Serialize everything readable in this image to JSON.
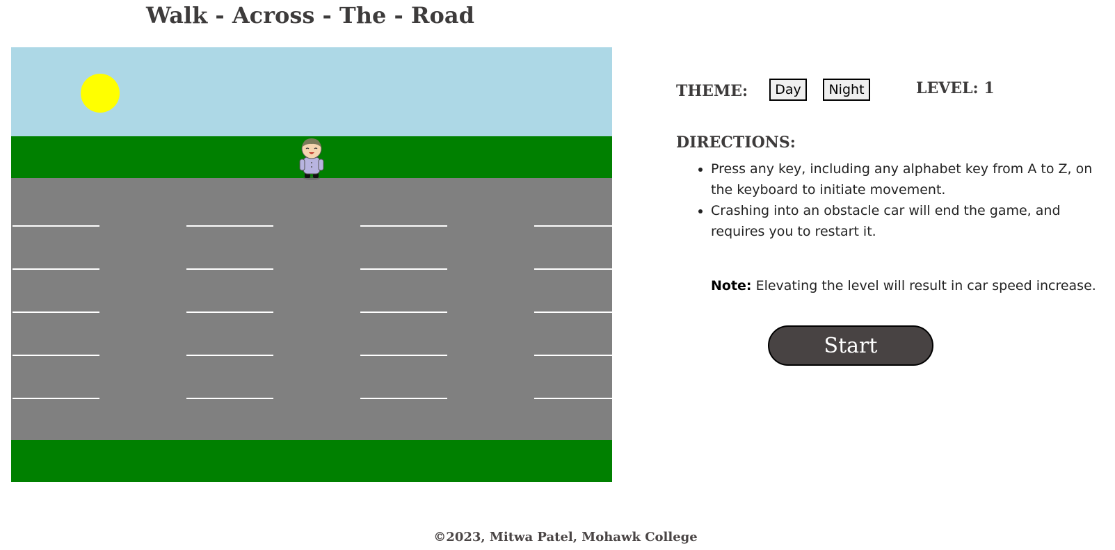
{
  "page_title": "Walk - Across - The - Road",
  "game": {
    "colors": {
      "sky": "#add8e6",
      "sun": "#ffff00",
      "grass": "#008000",
      "road": "#808080",
      "lane_line": "#ffffff"
    },
    "player_icon": "boy-character-icon"
  },
  "controls": {
    "theme_label": "THEME:",
    "day_button": "Day",
    "night_button": "Night",
    "level_label": "LEVEL: 1"
  },
  "directions": {
    "heading": "DIRECTIONS:",
    "items": [
      "Press any key, including any alphabet key from A to Z, on the keyboard to initiate movement.",
      "Crashing into an obstacle car will end the game, and requires you to restart it."
    ],
    "note_label": "Note:",
    "note_text": " Elevating the level will result in car speed increase."
  },
  "start_button": "Start",
  "footer": "©2023, Mitwa Patel, Mohawk College"
}
